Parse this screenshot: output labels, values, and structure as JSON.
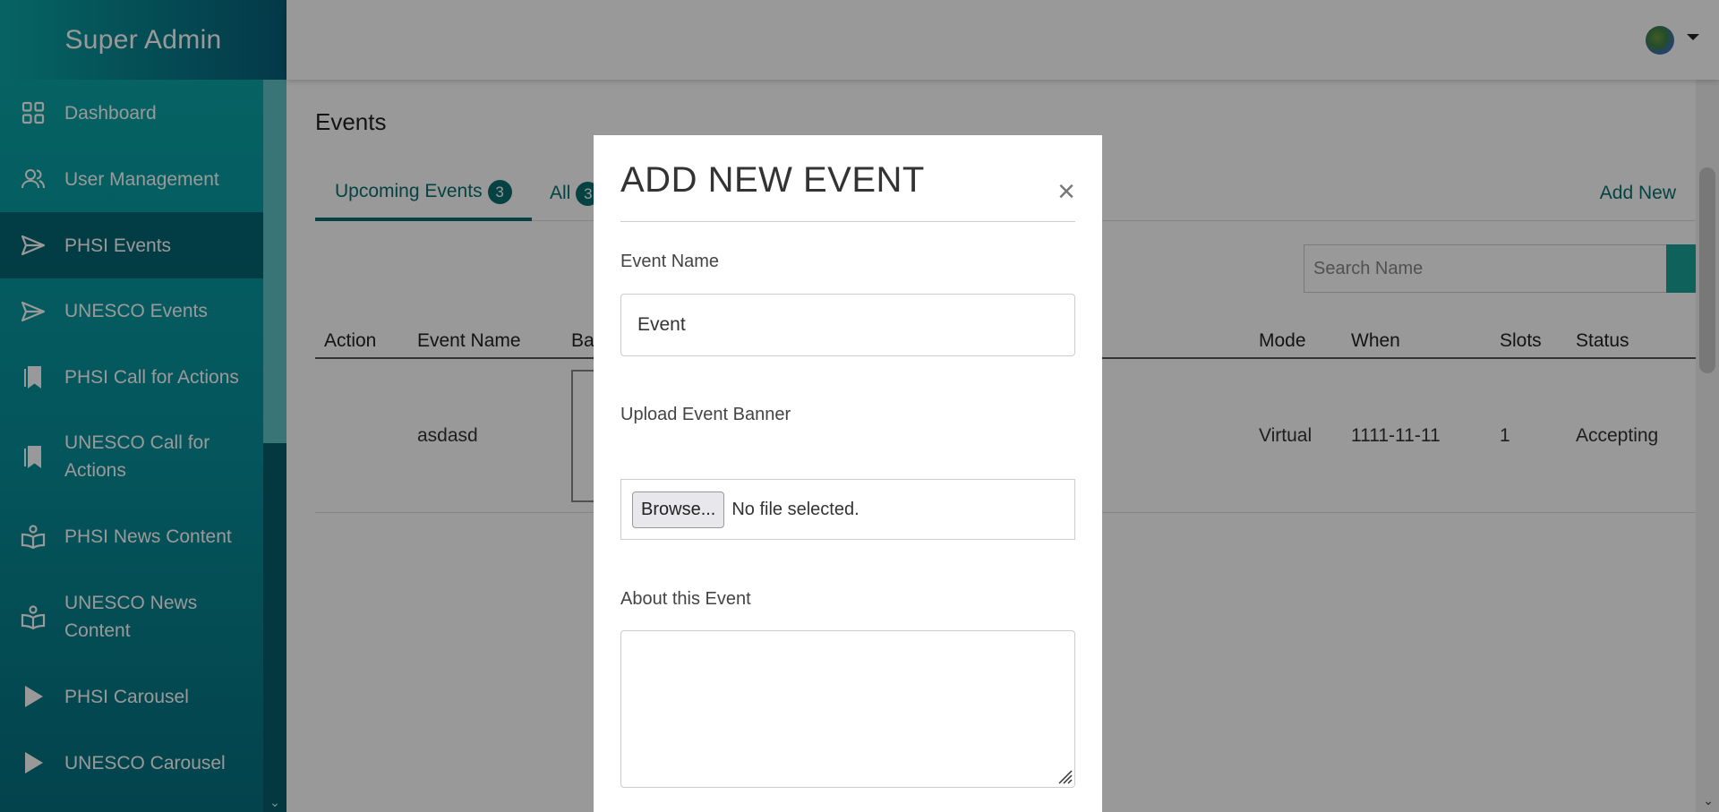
{
  "brand": "Super Admin",
  "sidebar": {
    "items": [
      {
        "label": "Dashboard",
        "icon": "grid-icon"
      },
      {
        "label": "User Management",
        "icon": "users-icon"
      },
      {
        "label": "PHSI Events",
        "icon": "send-icon",
        "active": true
      },
      {
        "label": "UNESCO Events",
        "icon": "send-icon"
      },
      {
        "label": "PHSI Call for Actions",
        "icon": "bookmark-icon"
      },
      {
        "label": "UNESCO Call for Actions",
        "icon": "bookmark-icon"
      },
      {
        "label": "PHSI News Content",
        "icon": "reader-icon"
      },
      {
        "label": "UNESCO News Content",
        "icon": "reader-icon"
      },
      {
        "label": "PHSI Carousel",
        "icon": "play-icon"
      },
      {
        "label": "UNESCO Carousel",
        "icon": "play-icon"
      }
    ]
  },
  "main": {
    "title": "Events",
    "tabs": [
      {
        "label": "Upcoming Events",
        "count": "3"
      },
      {
        "label": "All",
        "count": "3"
      }
    ],
    "add_new": "Add New",
    "search_placeholder": "Search Name",
    "table": {
      "headers": [
        "Action",
        "Event Name",
        "Ba",
        "Mode",
        "When",
        "Slots",
        "Status"
      ],
      "rows": [
        {
          "event_name": "asdasd",
          "mode": "Virtual",
          "when": "1111-11-11",
          "slots": "1",
          "status": "Accepting"
        }
      ]
    }
  },
  "modal": {
    "title": "ADD NEW EVENT",
    "close": "×",
    "event_name_label": "Event Name",
    "event_name_value": "Event",
    "banner_label": "Upload Event Banner",
    "browse_label": "Browse...",
    "file_status": "No file selected.",
    "about_label": "About this Event"
  },
  "colors": {
    "accent": "#0b6e6e",
    "sidebar_top": "#0aa8a8",
    "sidebar_bottom": "#06707f"
  }
}
